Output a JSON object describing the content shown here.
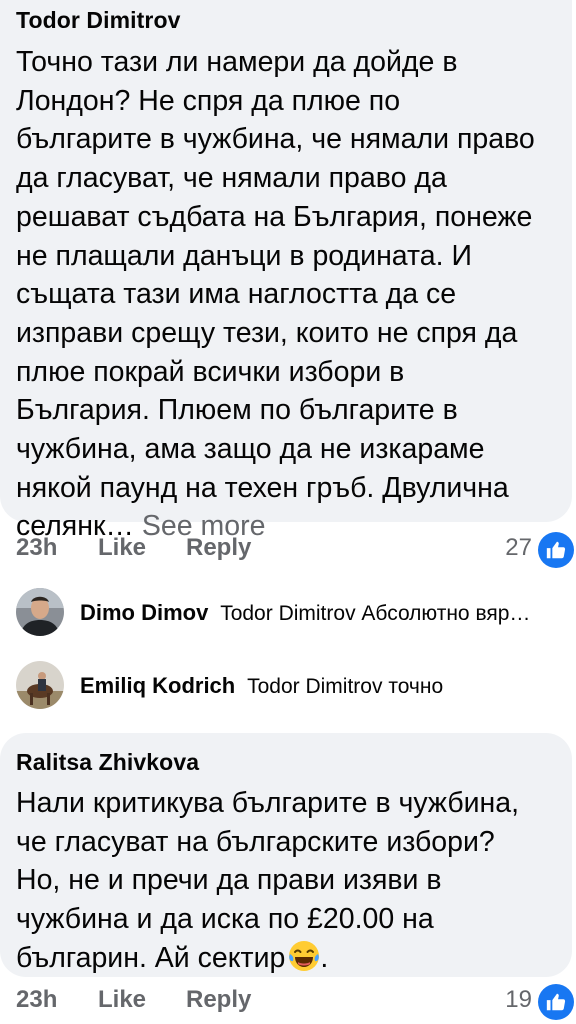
{
  "comment1": {
    "author": "Todor Dimitrov",
    "text": "Точно тази ли намери да дойде в\nЛондон? Не спря да плюе по\nбългарите в чужбина, че нямали право\nда гласуват, че нямали право да\nрешават съдбата на България, понеже\nне плащали данъци в родината. И\nсъщата тази има наглостта да се\nизправи срещу  тези, които не спря да\nплюе покрай всички избори в\nБългария. Плюем по българите в\nчужбина, ама защо да не изкараме\nнякой паунд на техен гръб. Двулична\nселянк…",
    "see_more": "See more",
    "time": "23h",
    "like_label": "Like",
    "reply_label": "Reply",
    "reaction_count": "27",
    "reaction_icon": "thumbs-up-icon"
  },
  "replies": [
    {
      "name": "Dimo Dimov",
      "mention": "Todor Dimitrov",
      "text": "Абсолютно вяр…",
      "avatar": "avatar-dimo"
    },
    {
      "name": "Emiliq Kodrich",
      "mention": "Todor Dimitrov",
      "text": "точно",
      "avatar": "avatar-emiliq"
    }
  ],
  "comment2": {
    "author": "Ralitsa Zhivkova",
    "text": "Нали критикува българите в чужбина,\nче гласуват на българските избори?\nНо, не и пречи да прави изяви в\nчужбина и да иска по £20.00 на\nбългарин. Ай сектир",
    "text_after_emoji": ".",
    "emoji": "laughing-crying-emoji",
    "time": "23h",
    "like_label": "Like",
    "reply_label": "Reply",
    "reaction_count": "19",
    "reaction_icon": "thumbs-up-icon"
  },
  "colors": {
    "bubble": "#f0f2f5",
    "meta_text": "#65676b",
    "like_blue": "#1877f2"
  }
}
